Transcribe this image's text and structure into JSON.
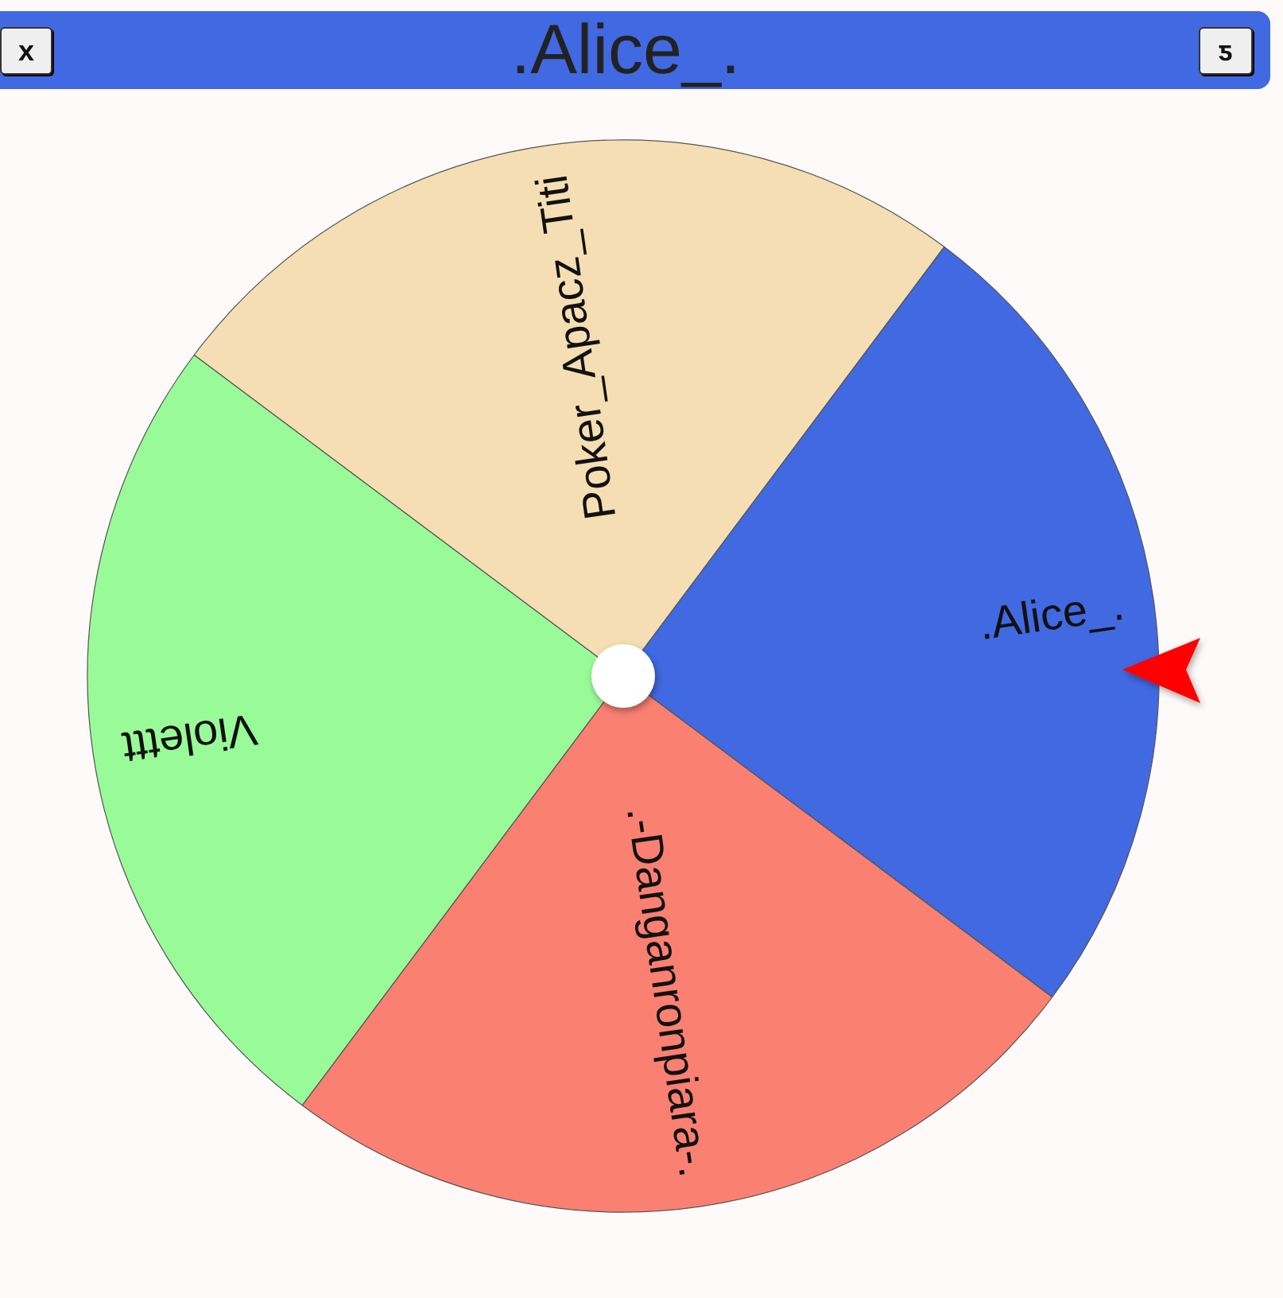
{
  "header": {
    "left_button": {
      "label": "x"
    },
    "title": ".Alice_.",
    "right_button": {
      "label": "ƽ"
    }
  },
  "wheel": {
    "segments": [
      {
        "label": ".Alice_.",
        "color": "#4169e1"
      },
      {
        "label": ".-Danganronpiara-.",
        "color": "#fa8072"
      },
      {
        "label": "Violettt",
        "color": "#98fb98"
      },
      {
        "label": "Poker_Apacz_Titi",
        "color": "#f5deb3"
      }
    ]
  }
}
